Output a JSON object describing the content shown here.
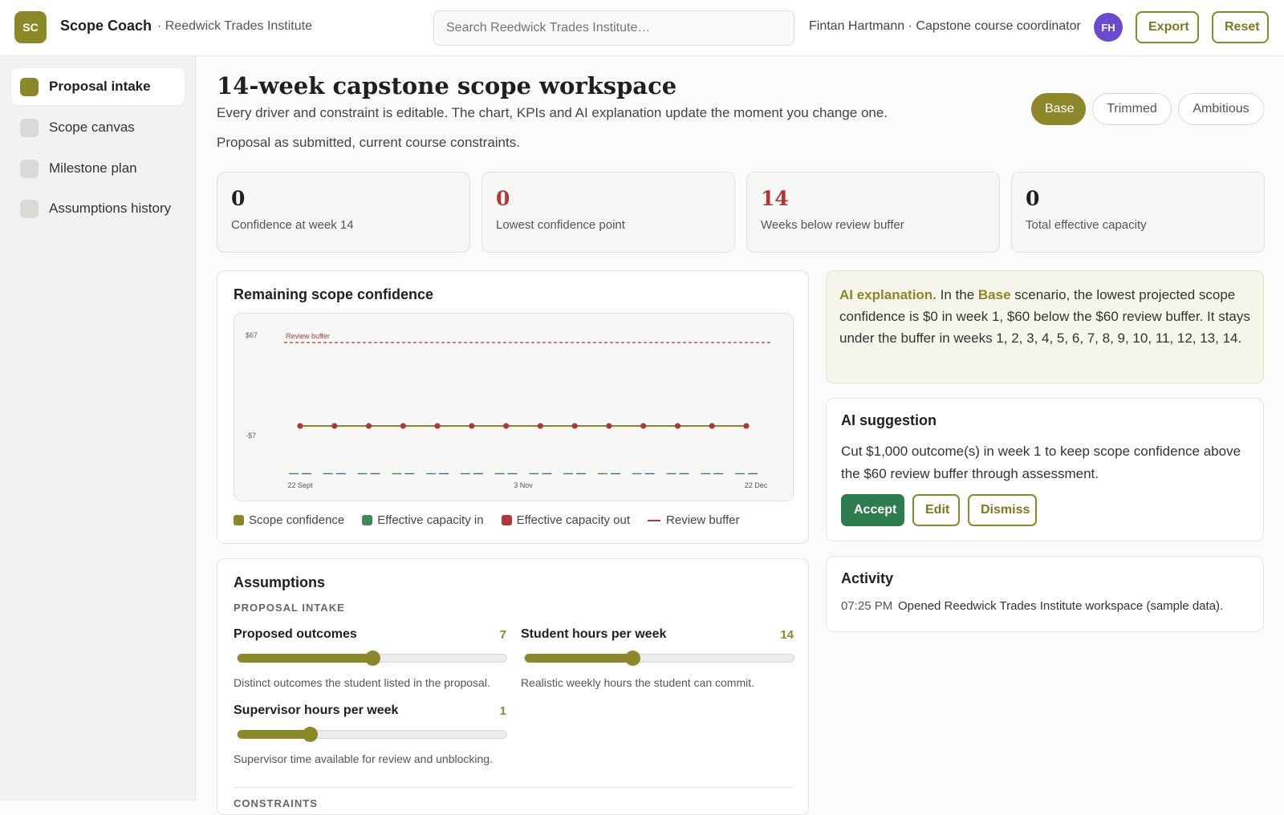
{
  "header": {
    "logo": "SC",
    "app_name": "Scope Coach",
    "org": "· Reedwick Trades Institute",
    "search_placeholder": "Search Reedwick Trades Institute…",
    "user": "Fintan Hartmann · Capstone course coordinator",
    "avatar": "FH",
    "export_label": "Export",
    "reset_label": "Reset"
  },
  "sidebar": {
    "items": [
      {
        "label": "Proposal intake",
        "active": true
      },
      {
        "label": "Scope canvas",
        "active": false
      },
      {
        "label": "Milestone plan",
        "active": false
      },
      {
        "label": "Assumptions history",
        "active": false
      }
    ]
  },
  "main": {
    "title": "14-week capstone scope workspace",
    "subtitle": "Every driver and constraint is editable. The chart, KPIs and AI explanation update the moment you change one.",
    "scenario_note": "Proposal as submitted, current course constraints.",
    "scenarios": [
      "Base",
      "Trimmed",
      "Ambitious"
    ],
    "active_scenario": "Base"
  },
  "kpis": [
    {
      "value": "0",
      "label": "Confidence at week 14",
      "alert": false
    },
    {
      "value": "0",
      "label": "Lowest confidence point",
      "alert": true
    },
    {
      "value": "14",
      "label": "Weeks below review buffer",
      "alert": true
    },
    {
      "value": "0",
      "label": "Total effective capacity",
      "alert": false
    }
  ],
  "chart_card": {
    "title": "Remaining scope confidence"
  },
  "chart_data": {
    "type": "line",
    "title": "Remaining scope confidence",
    "x_ticks": [
      "22 Sept",
      "3 Nov",
      "22 Dec"
    ],
    "y_ticks": [
      "$67",
      "-$7"
    ],
    "ylim": [
      -7,
      67
    ],
    "reference_line": {
      "name": "Review buffer",
      "value": 60
    },
    "series": [
      {
        "name": "Scope confidence",
        "color": "#8c8728",
        "values": [
          0,
          0,
          0,
          0,
          0,
          0,
          0,
          0,
          0,
          0,
          0,
          0,
          0,
          0
        ]
      },
      {
        "name": "Effective capacity in",
        "color": "#3f8a5a",
        "values": [
          0,
          0,
          0,
          0,
          0,
          0,
          0,
          0,
          0,
          0,
          0,
          0,
          0,
          0
        ]
      },
      {
        "name": "Effective capacity out",
        "color": "#b0373c",
        "values": [
          0,
          0,
          0,
          0,
          0,
          0,
          0,
          0,
          0,
          0,
          0,
          0,
          0,
          0
        ]
      }
    ],
    "legend": [
      "Scope confidence",
      "Effective capacity in",
      "Effective capacity out",
      "Review buffer"
    ],
    "grid": false,
    "legend_position": "bottom"
  },
  "ai_explanation": {
    "lead": "AI explanation.",
    "pre": " In the ",
    "scenario": "Base",
    "text": " scenario, the lowest projected scope confidence is $0 in week 1, $60 below the $60 review buffer. It stays under the buffer in weeks 1, 2, 3, 4, 5, 6, 7, 8, 9, 10, 11, 12, 13, 14."
  },
  "ai_suggestion": {
    "title": "AI suggestion",
    "text": "Cut $1,000 outcome(s) in week 1 to keep scope confidence above the $60 review buffer through assessment.",
    "accept": "Accept",
    "edit": "Edit",
    "dismiss": "Dismiss"
  },
  "activity": {
    "title": "Activity",
    "entries": [
      {
        "time": "07:25 PM",
        "text": "Opened Reedwick Trades Institute workspace (sample data)."
      }
    ]
  },
  "assumptions": {
    "title": "Assumptions",
    "section": "PROPOSAL INTAKE",
    "next_section": "CONSTRAINTS",
    "sliders": [
      {
        "label": "Proposed outcomes",
        "value": "7",
        "fraction": 0.5,
        "help": "Distinct outcomes the student listed in the proposal."
      },
      {
        "label": "Student hours per week",
        "value": "14",
        "fraction": 0.4,
        "help": "Realistic weekly hours the student can commit."
      },
      {
        "label": "Supervisor hours per week",
        "value": "1",
        "fraction": 0.27,
        "help": "Supervisor time available for review and unblocking."
      }
    ]
  }
}
